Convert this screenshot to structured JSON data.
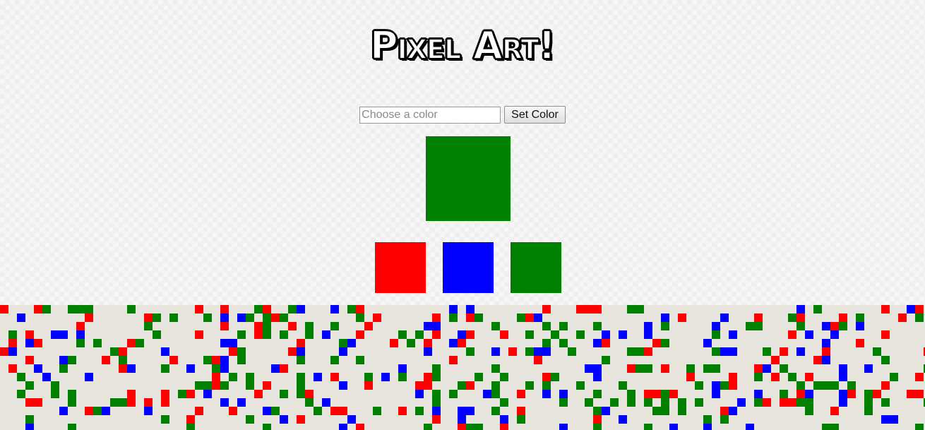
{
  "header": {
    "title": "Pixel Art!"
  },
  "controls": {
    "color_input_value": "",
    "color_input_placeholder": "Choose a color",
    "set_button_label": "Set Color"
  },
  "current_color": "green",
  "palette": [
    {
      "name": "red",
      "color": "red"
    },
    {
      "name": "blue",
      "color": "blue"
    },
    {
      "name": "green",
      "color": "green"
    }
  ],
  "canvas": {
    "background_color": "#e8e5df",
    "columns": 110,
    "rows": 15,
    "paint_colors": [
      "red",
      "blue",
      "green"
    ]
  }
}
